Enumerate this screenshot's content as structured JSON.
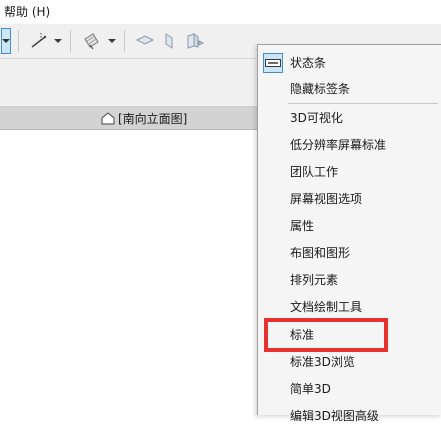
{
  "menubar": {
    "help": "帮助 (H)"
  },
  "toolbar": {
    "icons": [
      "selection-arrow-icon",
      "line-tool-icon",
      "surface-tool-icon",
      "plane-icon",
      "section-plane-icon",
      "render-icon"
    ]
  },
  "view_tab": {
    "label": "[南向立面图]",
    "icon": "house-icon"
  },
  "context_menu": {
    "items": [
      {
        "label": "状态条",
        "checked": true
      },
      {
        "label": "隐藏标签条",
        "checked": false
      },
      {
        "label": "3D可视化",
        "checked": false
      },
      {
        "label": "低分辨率屏幕标准",
        "checked": false
      },
      {
        "label": "团队工作",
        "checked": false
      },
      {
        "label": "屏幕视图选项",
        "checked": false
      },
      {
        "label": "属性",
        "checked": false
      },
      {
        "label": "布图和图形",
        "checked": false
      },
      {
        "label": "排列元素",
        "checked": false
      },
      {
        "label": "文档绘制工具",
        "checked": false
      },
      {
        "label": "标准",
        "checked": false
      },
      {
        "label": "标准3D浏览",
        "checked": false
      },
      {
        "label": "简单3D",
        "checked": false
      },
      {
        "label": "编辑3D视图高级",
        "checked": false
      }
    ]
  },
  "colors": {
    "highlight": "#e8322f",
    "checked_bg": "#cde6f7",
    "checked_border": "#3f8fd2"
  }
}
